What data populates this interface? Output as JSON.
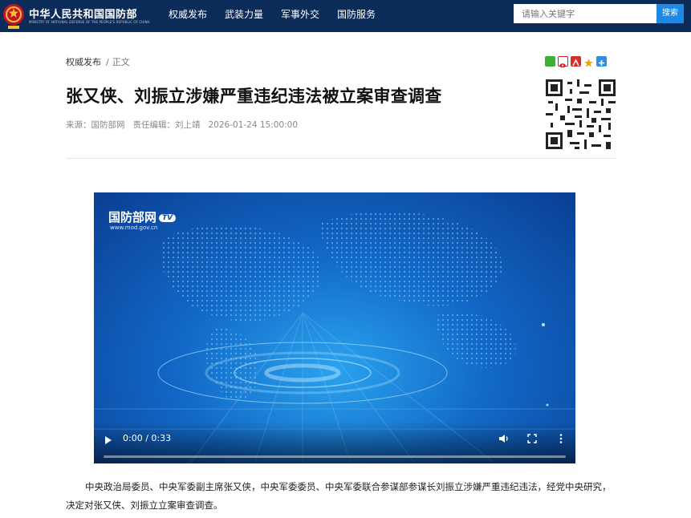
{
  "header": {
    "brand": "中华人民共和国国防部",
    "brand_sub": "MINISTRY OF NATIONAL DEFENSE OF THE PEOPLE'S REPUBLIC OF CHINA",
    "nav": [
      "权威发布",
      "武装力量",
      "军事外交",
      "国防服务"
    ],
    "search_placeholder": "请输入关键字",
    "search_button": "搜索",
    "bg_color": "#0b2b59"
  },
  "breadcrumb": {
    "section": "权威发布",
    "separator": "/",
    "current": "正文"
  },
  "share_icons": [
    "wechat-icon",
    "weibo-icon",
    "pdf-icon",
    "favorite-star-icon",
    "plus-icon"
  ],
  "article": {
    "title": "张又侠、刘振立涉嫌严重违纪违法被立案审查调查",
    "source": "来源：国防部网",
    "editor": "责任编辑：刘上靖",
    "datetime": "2026-01-24 15:00:00",
    "body": "中央政治局委员、中央军委副主席张又侠，中央军委委员、中央军委联合参谋部参谋长刘振立涉嫌严重违纪违法，经党中央研究，决定对张又侠、刘振立立案审查调查。"
  },
  "video": {
    "logo_text": "国防部网",
    "logo_badge": "TV",
    "url_text": "www.mod.gov.cn",
    "time": "0:00 / 0:33",
    "progress": 0
  }
}
